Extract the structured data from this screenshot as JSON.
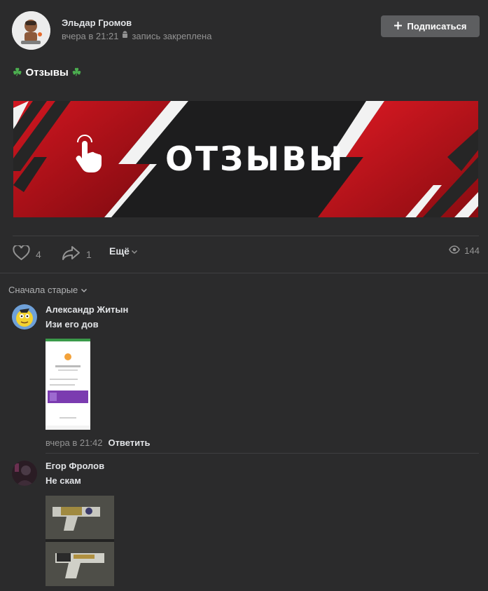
{
  "post": {
    "author": "Эльдар Громов",
    "time": "вчера в 21:21",
    "pinned": "запись закреплена",
    "subscribe_label": "Подписаться",
    "text": "Отзывы",
    "emoji": "☘",
    "banner_title": "ОТЗЫВЫ"
  },
  "actions": {
    "likes": "4",
    "shares": "1",
    "more_label": "Ещё",
    "views": "144"
  },
  "comments_section": {
    "sort_label": "Сначала старые",
    "items": [
      {
        "author": "Александр Житын",
        "text": "Изи его дов",
        "time": "вчера в 21:42",
        "reply_label": "Ответить"
      },
      {
        "author": "Егор Фролов",
        "text": "Не скам"
      }
    ]
  },
  "icons": {
    "like": "heart-icon",
    "share": "share-arrow-icon",
    "views": "eye-icon",
    "pin": "android-icon",
    "plus": "plus-icon",
    "dropdown": "chevron-down-icon"
  },
  "colors": {
    "background": "#2b2b2c",
    "banner_red": "#c2121a",
    "button": "#5d5e60",
    "accent_green": "#4caf50"
  }
}
